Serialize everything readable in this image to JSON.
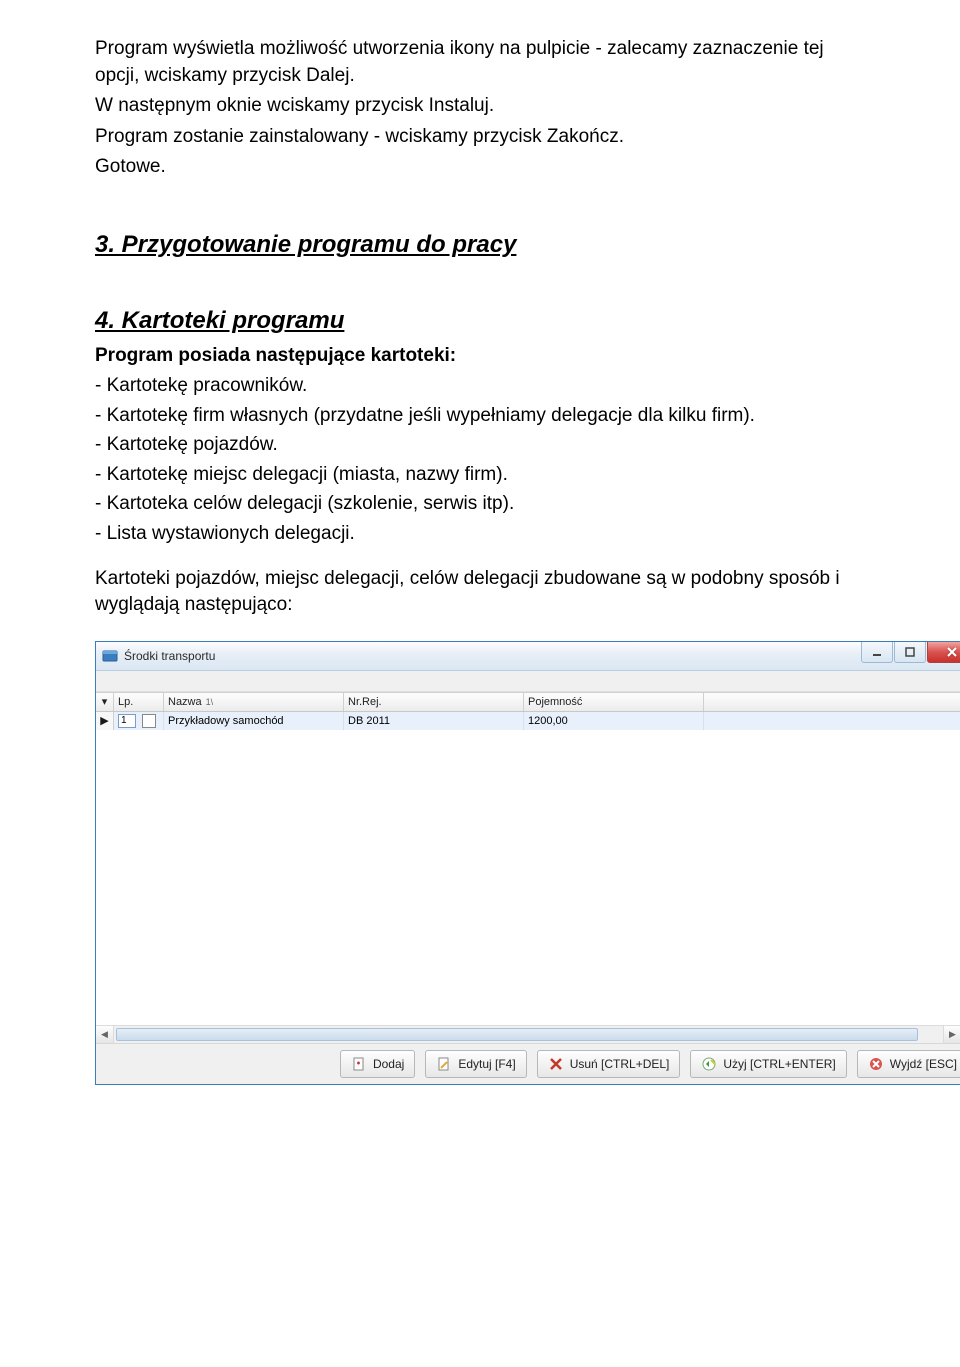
{
  "doc": {
    "intro_paragraphs": [
      "Program wyświetla możliwość utworzenia ikony na pulpicie - zalecamy zaznaczenie tej opcji, wciskamy przycisk Dalej.",
      "W następnym oknie wciskamy przycisk Instaluj.",
      "Program zostanie zainstalowany - wciskamy przycisk Zakończ.",
      "Gotowe."
    ],
    "heading_section3": "3. Przygotowanie programu do pracy",
    "heading_section4": "4. Kartoteki programu",
    "subheading": "Program posiada następujące kartoteki:",
    "list_items": [
      "- Kartotekę pracowników.",
      "- Kartotekę firm własnych (przydatne jeśli wypełniamy delegacje dla kilku firm).",
      "- Kartotekę pojazdów.",
      "- Kartotekę miejsc delegacji (miasta, nazwy firm).",
      "- Kartoteka celów delegacji (szkolenie, serwis itp).",
      "- Lista wystawionych delegacji."
    ],
    "post_text": "Kartoteki pojazdów, miejsc delegacji, celów delegacji zbudowane są w podobny sposób i wyglądają następująco:"
  },
  "window": {
    "title": "Środki transportu",
    "columns": {
      "lp": "Lp.",
      "nazwa": "Nazwa",
      "sort_indicator": "1\\",
      "nrrej": "Nr.Rej.",
      "pojemnosc": "Pojemność"
    },
    "row_indicator": "▶",
    "row": {
      "lp": "1",
      "nazwa": "Przykładowy samochód",
      "nrrej": "DB 2011",
      "pojemnosc": "1200,00"
    },
    "buttons": {
      "dodaj": "Dodaj",
      "edytuj": "Edytuj [F4]",
      "usun": "Usuń [CTRL+DEL]",
      "uzyj": "Użyj [CTRL+ENTER]",
      "wyjdz": "Wyjdź [ESC]"
    }
  }
}
